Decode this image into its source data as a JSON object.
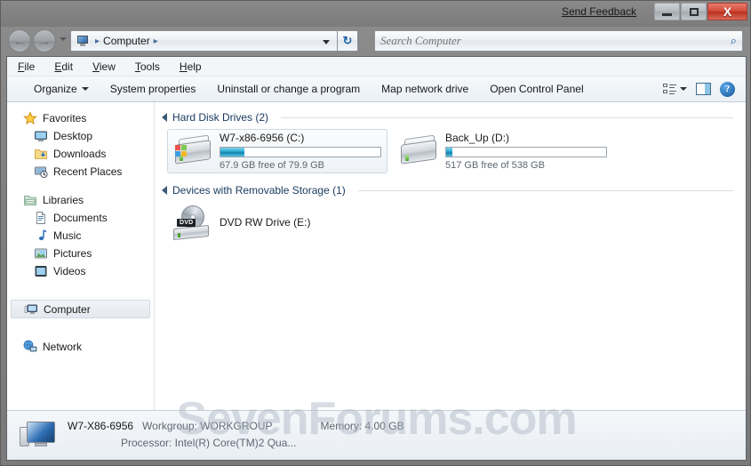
{
  "titlebar": {
    "send_feedback": "Send Feedback",
    "minimize_label": "Minimize",
    "maximize_label": "Maximize",
    "close_label": "X"
  },
  "navigation": {
    "back_glyph": "←",
    "forward_glyph": "→",
    "refresh_glyph": "↻",
    "address": {
      "root_crumb": "Computer",
      "sep": "▸"
    },
    "search": {
      "placeholder": "Search Computer",
      "value": "",
      "icon_glyph": "⌕"
    }
  },
  "menubar": {
    "items": [
      {
        "accel": "F",
        "rest": "ile"
      },
      {
        "accel": "E",
        "rest": "dit"
      },
      {
        "accel": "V",
        "rest": "iew"
      },
      {
        "accel": "T",
        "rest": "ools"
      },
      {
        "accel": "H",
        "rest": "elp"
      }
    ]
  },
  "toolbar": {
    "organize": "Organize",
    "system_properties": "System properties",
    "uninstall": "Uninstall or change a program",
    "map_network_drive": "Map network drive",
    "open_control_panel": "Open Control Panel",
    "help_glyph": "?"
  },
  "sidebar": {
    "groups": [
      {
        "header": "Favorites",
        "items": [
          {
            "label": "Desktop",
            "icon": "desktop-icon"
          },
          {
            "label": "Downloads",
            "icon": "downloads-icon"
          },
          {
            "label": "Recent Places",
            "icon": "recent-places-icon"
          }
        ]
      },
      {
        "header": "Libraries",
        "items": [
          {
            "label": "Documents",
            "icon": "documents-icon"
          },
          {
            "label": "Music",
            "icon": "music-icon"
          },
          {
            "label": "Pictures",
            "icon": "pictures-icon"
          },
          {
            "label": "Videos",
            "icon": "videos-icon"
          }
        ]
      }
    ],
    "computer": "Computer",
    "network": "Network"
  },
  "content": {
    "groups": [
      {
        "title": "Hard Disk Drives (2)",
        "drives": [
          {
            "name": "W7-x86-6956 (C:)",
            "free_text": "67.9 GB free of 79.9 GB",
            "used_percent": 15,
            "selected": true,
            "system": true
          },
          {
            "name": "Back_Up (D:)",
            "free_text": "517 GB free of 538 GB",
            "used_percent": 4,
            "selected": false,
            "system": false
          }
        ]
      },
      {
        "title": "Devices with Removable Storage (1)",
        "optical": [
          {
            "name": "DVD RW Drive (E:)",
            "badge": "DVD"
          }
        ]
      }
    ]
  },
  "statusbar": {
    "computer_name": "W7-X86-6956",
    "workgroup": "Workgroup: WORKGROUP",
    "memory": "Memory: 4.00 GB",
    "processor": "Processor: Intel(R) Core(TM)2 Qua..."
  },
  "watermark": {
    "text": "SevenForums.com"
  },
  "colors": {
    "accent_blue": "#1580ad",
    "close_red": "#b8301f",
    "group_title": "#17395e",
    "chrome_gray": "#7e7e7e"
  }
}
